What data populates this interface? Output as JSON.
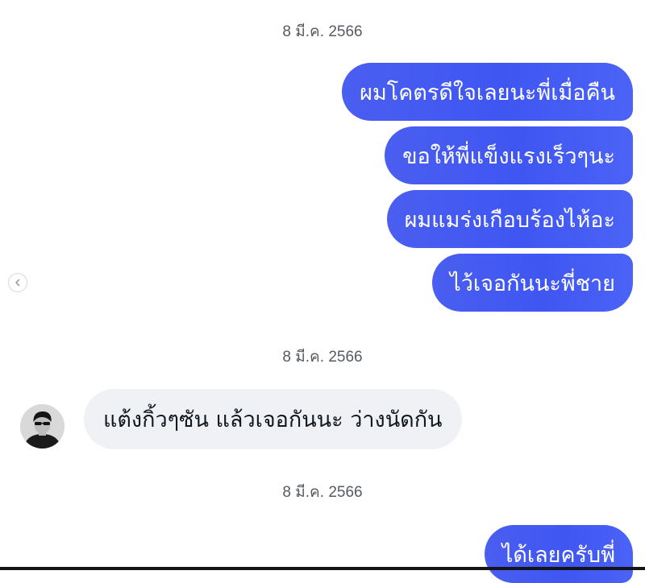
{
  "conversation": {
    "timestamps": [
      "8 มี.ค. 2566",
      "8 มี.ค. 2566",
      "8 มี.ค. 2566"
    ],
    "outgoing_group_1": [
      "ผมโคตรดีใจเลยนะพี่เมื่อคืน",
      "ขอให้พี่แข็งแรงเร็วๆนะ",
      "ผมแมร่งเกือบร้องไห้อะ",
      "ไว้เจอกันนะพี่ชาย"
    ],
    "incoming_message": "แต้งกิ้วๆซัน แล้วเจอกันนะ ว่างนัดกัน",
    "outgoing_group_2": [
      "ได้เลยครับพี่"
    ]
  },
  "icons": {
    "carousel_prev": "chevron-left-icon",
    "avatar": "user-avatar"
  },
  "colors": {
    "outgoing_bubble": "#3f56f2",
    "incoming_bubble": "#eff1f4",
    "timestamp_text": "#545b63"
  }
}
